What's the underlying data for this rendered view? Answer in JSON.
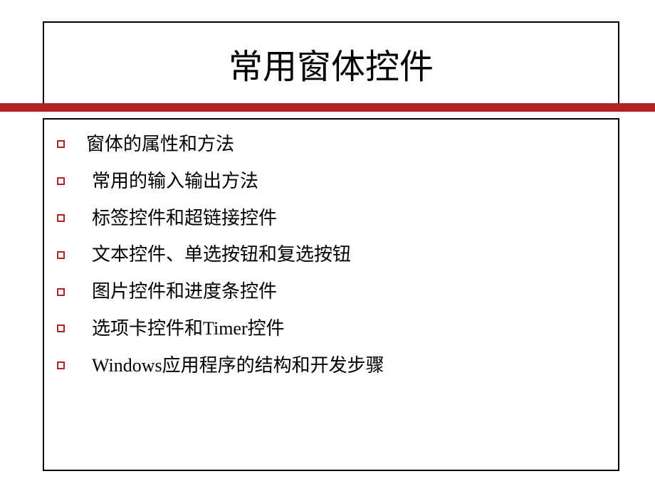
{
  "title": "常用窗体控件",
  "items": [
    {
      "text": "窗体的属性和方法"
    },
    {
      "text": "常用的输入输出方法"
    },
    {
      "text": "标签控件和超链接控件"
    },
    {
      "text": "文本控件、单选按钮和复选按钮"
    },
    {
      "text": "图片控件和进度条控件"
    },
    {
      "text": "选项卡控件和Timer控件"
    },
    {
      "text": "Windows应用程序的结构和开发步骤"
    }
  ],
  "accent_color": "#b22222"
}
